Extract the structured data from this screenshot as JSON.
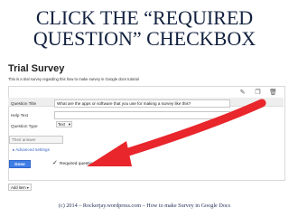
{
  "slide": {
    "title_line1": "CLICK THE “REQUIRED",
    "title_line2": "QUESTION” CHECKBOX",
    "footer": "(c) 2014 – Rockerjay.wordpress.com – How to make Survey in Google Docs"
  },
  "form": {
    "title": "Trial Survey",
    "description": "This is a trial survey regarding this how to make survey in Google docs tutorial",
    "toolbar_icons": [
      "pencil-icon",
      "copy-icon",
      "trash-icon"
    ]
  },
  "question": {
    "title_label": "Question Title",
    "title_value": "What are the apps or software that you use for making a survey like this?",
    "help_label": "Help Text",
    "help_value": "",
    "type_label": "Question Type",
    "type_value": "Text",
    "answer_placeholder": "Their answer",
    "advanced_label": "▸ Advanced settings",
    "done_label": "Done",
    "required_label": "Required question",
    "required_checked": true
  },
  "add_item_label": "Add item ▾",
  "colors": {
    "arrow": "#e8262c",
    "done_button": "#3f7de7",
    "title_text": "#12213f"
  }
}
